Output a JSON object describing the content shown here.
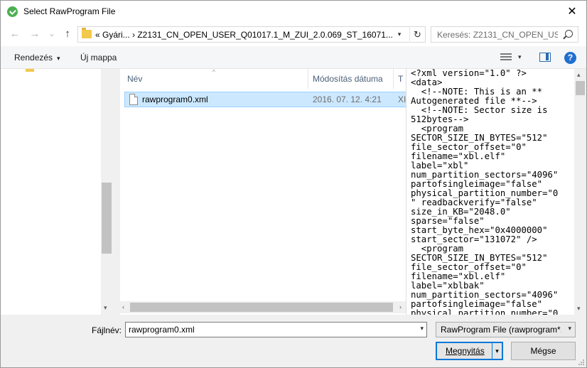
{
  "window": {
    "title": "Select RawProgram File",
    "close_glyph": "✕"
  },
  "nav": {
    "back_glyph": "←",
    "forward_glyph": "→",
    "history_glyph": "⌄",
    "up_glyph": "↑",
    "address": "«  Gyári...  ›  Z2131_CN_OPEN_USER_Q01017.1_M_ZUI_2.0.069_ST_16071...",
    "address_drop_glyph": "▾",
    "refresh_glyph": "↻",
    "search_placeholder": "Keresés: Z2131_CN_OPEN_US..."
  },
  "toolbar": {
    "organize_label": "Rendezés",
    "new_folder_label": "Új mappa",
    "caret_glyph": "▾"
  },
  "columns": {
    "name": "Név",
    "date": "Módosítás dátuma",
    "type": "T",
    "sort_glyph": "^"
  },
  "files": [
    {
      "name": "rawprogram0.xml",
      "date": "2016. 07. 12. 4:21",
      "type": "XI"
    }
  ],
  "scroll_glyphs": {
    "left": "‹",
    "right": "›",
    "up": "▴",
    "down": "▾"
  },
  "preview": {
    "text": "<?xml version=\"1.0\" ?>\n<data>\n  <!--NOTE: This is an **\nAutogenerated file **-->\n  <!--NOTE: Sector size is\n512bytes-->\n  <program\nSECTOR_SIZE_IN_BYTES=\"512\"\nfile_sector_offset=\"0\"\nfilename=\"xbl.elf\"\nlabel=\"xbl\"\nnum_partition_sectors=\"4096\"\npartofsingleimage=\"false\"\nphysical_partition_number=\"0\n\" readbackverify=\"false\"\nsize_in_KB=\"2048.0\"\nsparse=\"false\"\nstart_byte_hex=\"0x4000000\"\nstart_sector=\"131072\" />\n  <program\nSECTOR_SIZE_IN_BYTES=\"512\"\nfile_sector_offset=\"0\"\nfilename=\"xbl.elf\"\nlabel=\"xblbak\"\nnum_partition_sectors=\"4096\"\npartofsingleimage=\"false\"\nphysical_partition_number=\"0"
  },
  "bottom": {
    "filename_label": "Fájlnév:",
    "filename_value": "rawprogram0.xml",
    "filter_value": "RawProgram File (rawprogram*.x",
    "open_label": "Megnyitás",
    "cancel_label": "Mégse"
  }
}
